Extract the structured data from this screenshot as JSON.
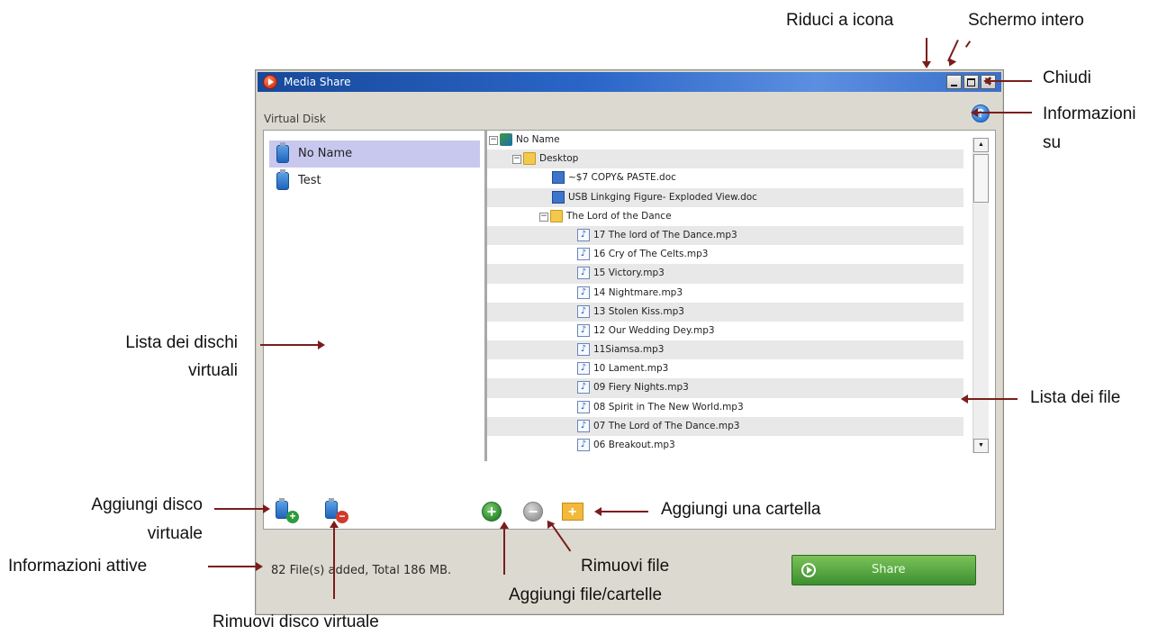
{
  "window": {
    "title": "Media Share",
    "buttons": {
      "minimize": "_",
      "maximize": "□",
      "close": "✕"
    },
    "virtual_disk_label": "Virtual Disk",
    "help_icon": "?"
  },
  "disk_list": [
    {
      "label": "No Name",
      "selected": true
    },
    {
      "label": "Test",
      "selected": false
    }
  ],
  "file_tree": [
    {
      "label": "No Name",
      "icon": "computer-icon",
      "level": 0,
      "expander": "⊟"
    },
    {
      "label": "Desktop",
      "icon": "folder-icon",
      "level": 1,
      "expander": "⊟"
    },
    {
      "label": "~$7 COPY& PASTE.doc",
      "icon": "doc-icon",
      "level": 2
    },
    {
      "label": "USB Linkging Figure- Exploded View.doc",
      "icon": "doc-icon",
      "level": 2
    },
    {
      "label": "The Lord of the Dance",
      "icon": "folder-icon",
      "level": 2,
      "expander": "⊟"
    },
    {
      "label": "17 The lord of The Dance.mp3",
      "icon": "music-file-icon",
      "level": 3
    },
    {
      "label": "16 Cry of The Celts.mp3",
      "icon": "music-file-icon",
      "level": 3
    },
    {
      "label": "15 Victory.mp3",
      "icon": "music-file-icon",
      "level": 3
    },
    {
      "label": "14 Nightmare.mp3",
      "icon": "music-file-icon",
      "level": 3
    },
    {
      "label": "13 Stolen Kiss.mp3",
      "icon": "music-file-icon",
      "level": 3
    },
    {
      "label": "12 Our Wedding Dey.mp3",
      "icon": "music-file-icon",
      "level": 3
    },
    {
      "label": "11Siamsa.mp3",
      "icon": "music-file-icon",
      "level": 3
    },
    {
      "label": "10 Lament.mp3",
      "icon": "music-file-icon",
      "level": 3
    },
    {
      "label": "09 Fiery Nights.mp3",
      "icon": "music-file-icon",
      "level": 3
    },
    {
      "label": "08 Spirit in The New World.mp3",
      "icon": "music-file-icon",
      "level": 3
    },
    {
      "label": "07 The Lord of The Dance.mp3",
      "icon": "music-file-icon",
      "level": 3
    },
    {
      "label": "06 Breakout.mp3",
      "icon": "music-file-icon",
      "level": 3
    }
  ],
  "status": {
    "text": "82 File(s) added, Total 186 MB."
  },
  "share_button": {
    "label": "Share"
  },
  "annotations": {
    "minimize": "Riduci a icona",
    "fullscreen": "Schermo intero",
    "close": "Chiudi",
    "info_line1": "Informazioni",
    "info_line2": "su",
    "disk_list_line1": "Lista dei dischi",
    "disk_list_line2": "virtuali",
    "file_list": "Lista dei file",
    "add_disk_line1": "Aggiungi disco",
    "add_disk_line2": "virtuale",
    "active_info": "Informazioni attive",
    "remove_disk": "Rimuovi disco virtuale",
    "add_folder": "Aggiungi una cartella",
    "remove_file": "Rimuovi file",
    "add_files": "Aggiungi file/cartelle"
  },
  "colors": {
    "titlebar": "#2b66c8",
    "window_bg": "#dcdad0",
    "arrow": "#7b1c1c",
    "share_green": "#4f9f3a",
    "selection": "#c8c8ef"
  }
}
